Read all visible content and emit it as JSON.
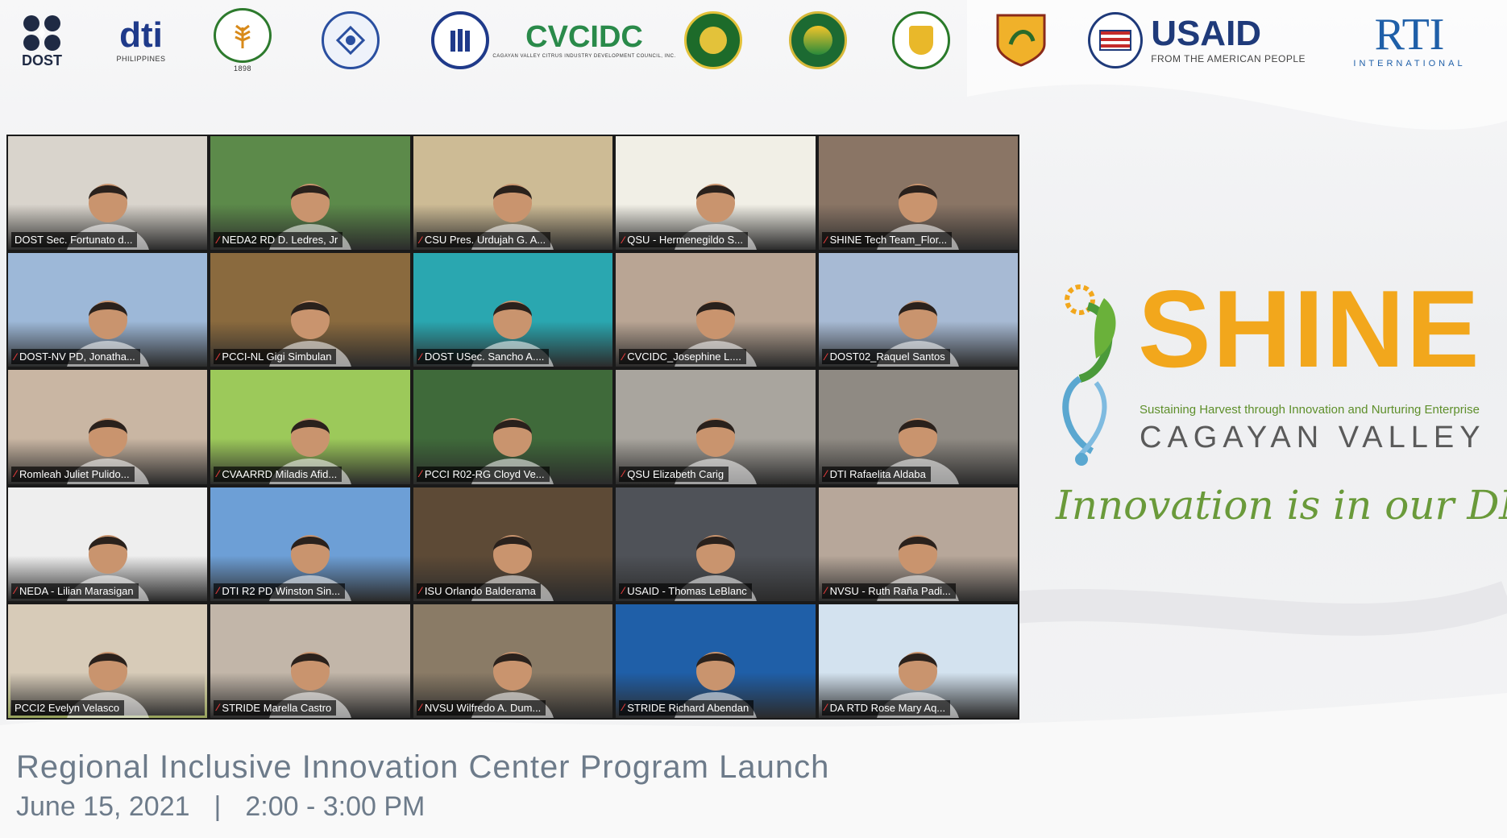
{
  "logos": {
    "dost": {
      "text": "DOST"
    },
    "dti": {
      "text": "dti",
      "caption": "PHILIPPINES"
    },
    "da": {
      "caption": "1898"
    },
    "cvcidc": {
      "text": "CVCIDC",
      "caption": "CAGAYAN VALLEY CITRUS INDUSTRY DEVELOPMENT COUNCIL, INC."
    },
    "usaid": {
      "text": "USAID",
      "caption": "FROM THE AMERICAN PEOPLE"
    },
    "rti": {
      "text": "RTI",
      "caption": "INTERNATIONAL"
    }
  },
  "participants": [
    {
      "name": "DOST Sec. Fortunato d...",
      "muted": false,
      "bg": "#d9d4cc"
    },
    {
      "name": "NEDA2  RD D. Ledres, Jr",
      "muted": true,
      "bg": "#5c8a4a"
    },
    {
      "name": "CSU Pres. Urdujah G. A...",
      "muted": true,
      "bg": "#cdbb95"
    },
    {
      "name": "QSU - Hermenegildo S...",
      "muted": true,
      "bg": "#f1efe6"
    },
    {
      "name": "SHINE Tech Team_Flor...",
      "muted": true,
      "bg": "#8a7565"
    },
    {
      "name": "DOST-NV PD, Jonatha...",
      "muted": true,
      "bg": "#9db8d8"
    },
    {
      "name": "PCCI-NL Gigi Simbulan",
      "muted": true,
      "bg": "#8a6a3e"
    },
    {
      "name": "DOST USec. Sancho A....",
      "muted": true,
      "bg": "#2aa7b0"
    },
    {
      "name": "CVCIDC_Josephine L....",
      "muted": true,
      "bg": "#b9a594"
    },
    {
      "name": "DOST02_Raquel Santos",
      "muted": true,
      "bg": "#a7bad4"
    },
    {
      "name": "Romleah Juliet Pulido...",
      "muted": true,
      "bg": "#c9b6a3"
    },
    {
      "name": "CVAARRD Miladis Afid...",
      "muted": true,
      "bg": "#9cc95a"
    },
    {
      "name": "PCCI R02-RG Cloyd Ve...",
      "muted": true,
      "bg": "#3f6a3a"
    },
    {
      "name": "QSU Elizabeth Carig",
      "muted": true,
      "bg": "#a9a59e"
    },
    {
      "name": "DTI Rafaelita Aldaba",
      "muted": true,
      "bg": "#8f8a83"
    },
    {
      "name": "NEDA - Lilian Marasigan",
      "muted": true,
      "bg": "#eeeeee"
    },
    {
      "name": "DTI R2 PD Winston Sin...",
      "muted": true,
      "bg": "#6d9fd6"
    },
    {
      "name": "ISU Orlando Balderama",
      "muted": true,
      "bg": "#5d4a36"
    },
    {
      "name": "USAID - Thomas LeBlanc",
      "muted": true,
      "bg": "#4f5258"
    },
    {
      "name": "NVSU - Ruth Raña Padi...",
      "muted": true,
      "bg": "#b7a79a"
    },
    {
      "name": "PCCI2 Evelyn Velasco",
      "muted": false,
      "bg": "#d7cbb8"
    },
    {
      "name": "STRIDE Marella Castro",
      "muted": true,
      "bg": "#c2b6a9"
    },
    {
      "name": "NVSU Wilfredo A. Dum...",
      "muted": true,
      "bg": "#8a7b66"
    },
    {
      "name": "STRIDE Richard Abendan",
      "muted": true,
      "bg": "#1f5fa8"
    },
    {
      "name": "DA RTD Rose Mary Aq...",
      "muted": true,
      "bg": "#d3e2ef"
    }
  ],
  "brand": {
    "word": "SHINE",
    "sub": "Sustaining Harvest through Innovation and Nurturing Enterprise",
    "region": "CAGAYAN VALLEY",
    "tagline": "Innovation is in our DNA"
  },
  "event": {
    "title": "Regional Inclusive Innovation Center Program Launch",
    "date": "June 15, 2021",
    "separator": "|",
    "time": "2:00 - 3:00 PM"
  }
}
